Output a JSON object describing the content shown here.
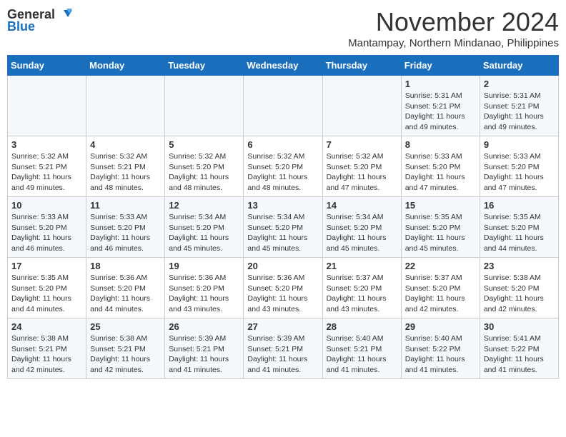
{
  "header": {
    "logo_line1": "General",
    "logo_line2": "Blue",
    "month_year": "November 2024",
    "location": "Mantampay, Northern Mindanao, Philippines"
  },
  "weekdays": [
    "Sunday",
    "Monday",
    "Tuesday",
    "Wednesday",
    "Thursday",
    "Friday",
    "Saturday"
  ],
  "weeks": [
    [
      {
        "day": "",
        "info": ""
      },
      {
        "day": "",
        "info": ""
      },
      {
        "day": "",
        "info": ""
      },
      {
        "day": "",
        "info": ""
      },
      {
        "day": "",
        "info": ""
      },
      {
        "day": "1",
        "info": "Sunrise: 5:31 AM\nSunset: 5:21 PM\nDaylight: 11 hours and 49 minutes."
      },
      {
        "day": "2",
        "info": "Sunrise: 5:31 AM\nSunset: 5:21 PM\nDaylight: 11 hours and 49 minutes."
      }
    ],
    [
      {
        "day": "3",
        "info": "Sunrise: 5:32 AM\nSunset: 5:21 PM\nDaylight: 11 hours and 49 minutes."
      },
      {
        "day": "4",
        "info": "Sunrise: 5:32 AM\nSunset: 5:21 PM\nDaylight: 11 hours and 48 minutes."
      },
      {
        "day": "5",
        "info": "Sunrise: 5:32 AM\nSunset: 5:20 PM\nDaylight: 11 hours and 48 minutes."
      },
      {
        "day": "6",
        "info": "Sunrise: 5:32 AM\nSunset: 5:20 PM\nDaylight: 11 hours and 48 minutes."
      },
      {
        "day": "7",
        "info": "Sunrise: 5:32 AM\nSunset: 5:20 PM\nDaylight: 11 hours and 47 minutes."
      },
      {
        "day": "8",
        "info": "Sunrise: 5:33 AM\nSunset: 5:20 PM\nDaylight: 11 hours and 47 minutes."
      },
      {
        "day": "9",
        "info": "Sunrise: 5:33 AM\nSunset: 5:20 PM\nDaylight: 11 hours and 47 minutes."
      }
    ],
    [
      {
        "day": "10",
        "info": "Sunrise: 5:33 AM\nSunset: 5:20 PM\nDaylight: 11 hours and 46 minutes."
      },
      {
        "day": "11",
        "info": "Sunrise: 5:33 AM\nSunset: 5:20 PM\nDaylight: 11 hours and 46 minutes."
      },
      {
        "day": "12",
        "info": "Sunrise: 5:34 AM\nSunset: 5:20 PM\nDaylight: 11 hours and 45 minutes."
      },
      {
        "day": "13",
        "info": "Sunrise: 5:34 AM\nSunset: 5:20 PM\nDaylight: 11 hours and 45 minutes."
      },
      {
        "day": "14",
        "info": "Sunrise: 5:34 AM\nSunset: 5:20 PM\nDaylight: 11 hours and 45 minutes."
      },
      {
        "day": "15",
        "info": "Sunrise: 5:35 AM\nSunset: 5:20 PM\nDaylight: 11 hours and 45 minutes."
      },
      {
        "day": "16",
        "info": "Sunrise: 5:35 AM\nSunset: 5:20 PM\nDaylight: 11 hours and 44 minutes."
      }
    ],
    [
      {
        "day": "17",
        "info": "Sunrise: 5:35 AM\nSunset: 5:20 PM\nDaylight: 11 hours and 44 minutes."
      },
      {
        "day": "18",
        "info": "Sunrise: 5:36 AM\nSunset: 5:20 PM\nDaylight: 11 hours and 44 minutes."
      },
      {
        "day": "19",
        "info": "Sunrise: 5:36 AM\nSunset: 5:20 PM\nDaylight: 11 hours and 43 minutes."
      },
      {
        "day": "20",
        "info": "Sunrise: 5:36 AM\nSunset: 5:20 PM\nDaylight: 11 hours and 43 minutes."
      },
      {
        "day": "21",
        "info": "Sunrise: 5:37 AM\nSunset: 5:20 PM\nDaylight: 11 hours and 43 minutes."
      },
      {
        "day": "22",
        "info": "Sunrise: 5:37 AM\nSunset: 5:20 PM\nDaylight: 11 hours and 42 minutes."
      },
      {
        "day": "23",
        "info": "Sunrise: 5:38 AM\nSunset: 5:20 PM\nDaylight: 11 hours and 42 minutes."
      }
    ],
    [
      {
        "day": "24",
        "info": "Sunrise: 5:38 AM\nSunset: 5:21 PM\nDaylight: 11 hours and 42 minutes."
      },
      {
        "day": "25",
        "info": "Sunrise: 5:38 AM\nSunset: 5:21 PM\nDaylight: 11 hours and 42 minutes."
      },
      {
        "day": "26",
        "info": "Sunrise: 5:39 AM\nSunset: 5:21 PM\nDaylight: 11 hours and 41 minutes."
      },
      {
        "day": "27",
        "info": "Sunrise: 5:39 AM\nSunset: 5:21 PM\nDaylight: 11 hours and 41 minutes."
      },
      {
        "day": "28",
        "info": "Sunrise: 5:40 AM\nSunset: 5:21 PM\nDaylight: 11 hours and 41 minutes."
      },
      {
        "day": "29",
        "info": "Sunrise: 5:40 AM\nSunset: 5:22 PM\nDaylight: 11 hours and 41 minutes."
      },
      {
        "day": "30",
        "info": "Sunrise: 5:41 AM\nSunset: 5:22 PM\nDaylight: 11 hours and 41 minutes."
      }
    ]
  ]
}
